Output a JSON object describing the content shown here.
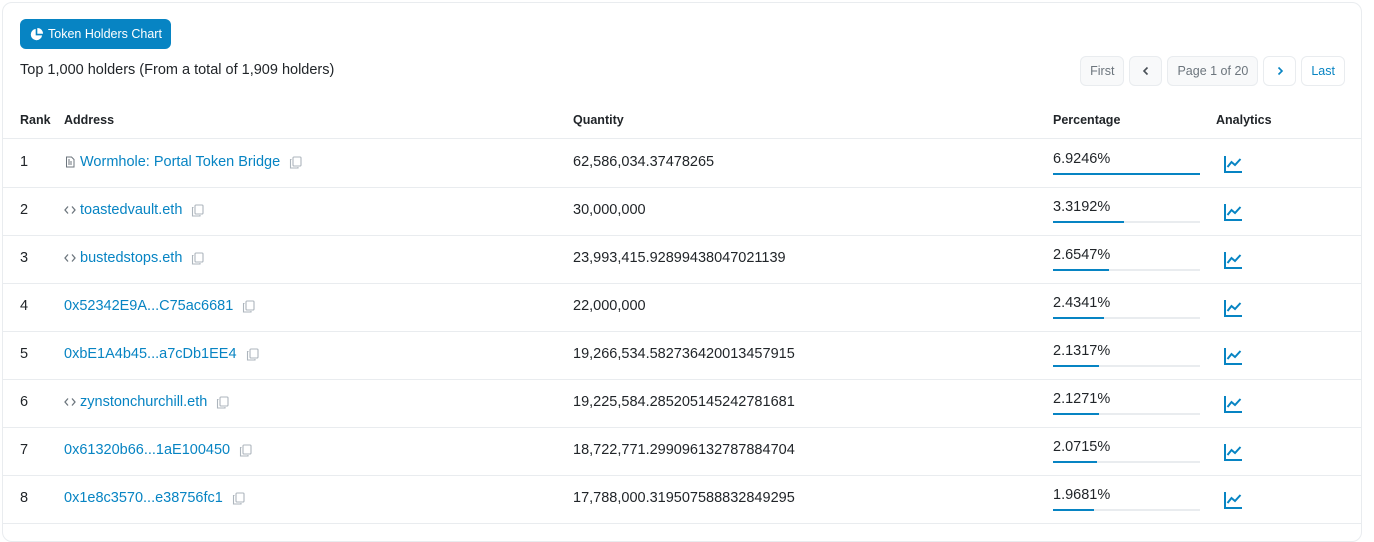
{
  "header": {
    "chart_button": "Token Holders Chart",
    "summary": "Top 1,000 holders (From a total of 1,909 holders)"
  },
  "pagination": {
    "first": "First",
    "page": "Page 1 of 20",
    "last": "Last"
  },
  "columns": {
    "rank": "Rank",
    "address": "Address",
    "quantity": "Quantity",
    "percentage": "Percentage",
    "analytics": "Analytics"
  },
  "rows": [
    {
      "rank": "1",
      "address": "Wormhole: Portal Token Bridge",
      "icon": "contract-icon",
      "quantity": "62,586,034.37478265",
      "percentage": "6.9246%",
      "bar_fraction": 1.0
    },
    {
      "rank": "2",
      "address": "toastedvault.eth",
      "icon": "code-icon",
      "quantity": "30,000,000",
      "percentage": "3.3192%",
      "bar_fraction": 0.48
    },
    {
      "rank": "3",
      "address": "bustedstops.eth",
      "icon": "code-icon",
      "quantity": "23,993,415.92899438047021139",
      "percentage": "2.6547%",
      "bar_fraction": 0.38
    },
    {
      "rank": "4",
      "address": "0x52342E9A...C75ac6681",
      "icon": "",
      "quantity": "22,000,000",
      "percentage": "2.4341%",
      "bar_fraction": 0.35
    },
    {
      "rank": "5",
      "address": "0xbE1A4b45...a7cDb1EE4",
      "icon": "",
      "quantity": "19,266,534.582736420013457915",
      "percentage": "2.1317%",
      "bar_fraction": 0.31
    },
    {
      "rank": "6",
      "address": "zynstonchurchill.eth",
      "icon": "code-icon",
      "quantity": "19,225,584.285205145242781681",
      "percentage": "2.1271%",
      "bar_fraction": 0.31
    },
    {
      "rank": "7",
      "address": "0x61320b66...1aE100450",
      "icon": "",
      "quantity": "18,722,771.299096132787884704",
      "percentage": "2.0715%",
      "bar_fraction": 0.3
    },
    {
      "rank": "8",
      "address": "0x1e8c3570...e38756fc1",
      "icon": "",
      "quantity": "17,788,000.319507588832849295",
      "percentage": "1.9681%",
      "bar_fraction": 0.28
    }
  ],
  "colors": {
    "accent": "#0784c3",
    "border": "#e9ecef",
    "muted": "#6c757d"
  }
}
